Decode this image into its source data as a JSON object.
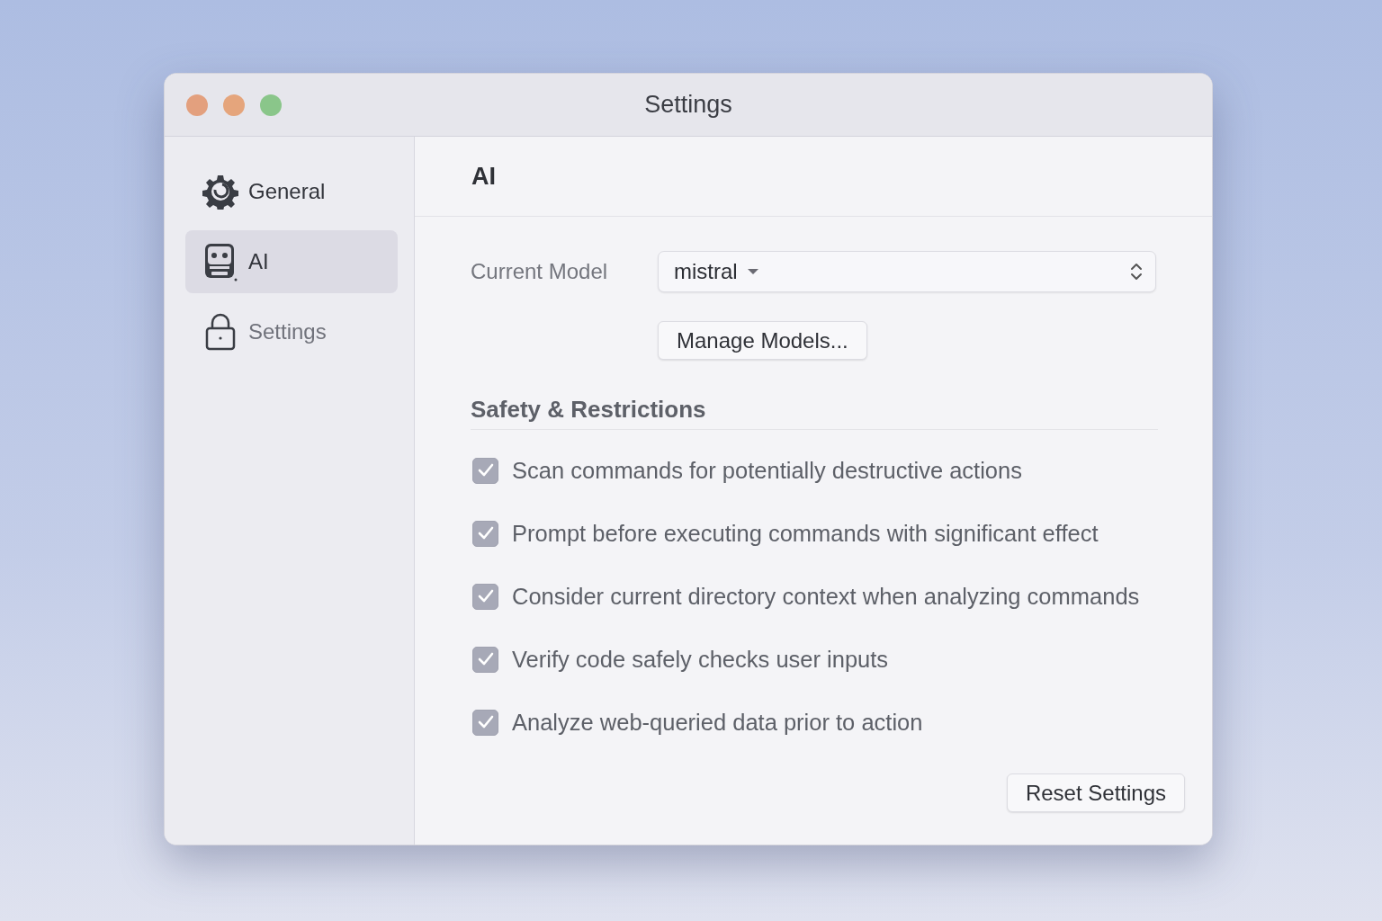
{
  "window": {
    "title": "Settings"
  },
  "sidebar": {
    "items": [
      {
        "kind": "gear",
        "label": "General",
        "selected": false,
        "disabled": false
      },
      {
        "kind": "robot",
        "label": "AI",
        "selected": true,
        "disabled": false
      },
      {
        "kind": "lock",
        "label": "Settings",
        "selected": false,
        "disabled": true
      }
    ]
  },
  "page": {
    "title": "AI",
    "model": {
      "label": "Current Model",
      "value": "mistral"
    },
    "manage_button": "Manage Models...",
    "section_title": "Safety & Restrictions",
    "options": [
      {
        "label": "Scan commands for potentially destructive actions",
        "checked": true
      },
      {
        "label": "Prompt before executing commands with significant effect",
        "checked": true
      },
      {
        "label": "Consider current directory context when analyzing commands",
        "checked": true
      },
      {
        "label": "Verify code safely checks user inputs",
        "checked": true
      },
      {
        "label": "Analyze web-queried data prior to action",
        "checked": true
      }
    ],
    "reset_button": "Reset Settings"
  }
}
